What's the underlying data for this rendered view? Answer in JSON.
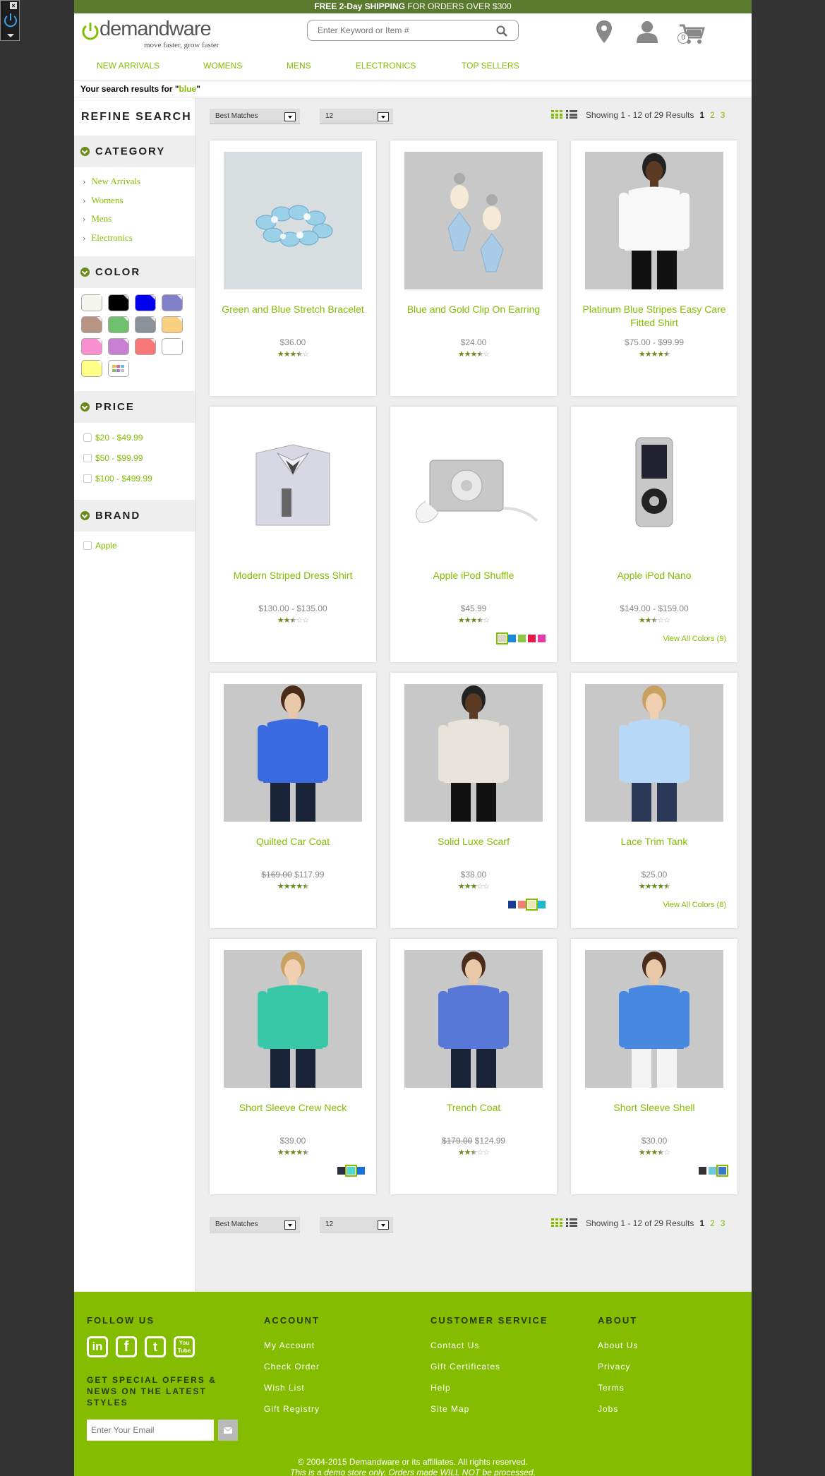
{
  "promo": {
    "bold": "FREE 2-Day SHIPPING",
    "rest": " FOR ORDERS OVER $300"
  },
  "logo": {
    "name": "demandware",
    "tagline": "move faster, grow faster"
  },
  "search": {
    "placeholder": "Enter Keyword or Item #"
  },
  "cart": {
    "count": "0"
  },
  "nav": [
    "NEW ARRIVALS",
    "WOMENS",
    "MENS",
    "ELECTRONICS",
    "TOP SELLERS"
  ],
  "results": {
    "prefix": "Your search results for \"",
    "query": "blue",
    "suffix": "\""
  },
  "sidebar": {
    "refine_title": "REFINE SEARCH",
    "category_title": "CATEGORY",
    "categories": [
      "New Arrivals",
      "Womens",
      "Mens",
      "Electronics"
    ],
    "color_title": "COLOR",
    "colors": [
      "#f5f5ef",
      "#000000",
      "#0000ee",
      "#8080c8",
      "#b89484",
      "#70c070",
      "#8c9098",
      "#f8d080",
      "#f890d0",
      "#c880d0",
      "#f87878",
      "#ffffff",
      "#ffff88",
      "multicolor"
    ],
    "price_title": "PRICE",
    "prices": [
      "$20 - $49.99",
      "$50 - $99.99",
      "$100 - $499.99"
    ],
    "brand_title": "BRAND",
    "brands": [
      "Apple"
    ]
  },
  "toolbar": {
    "sort_value": "Best Matches",
    "per_page_value": "12",
    "showing": "Showing 1 - 12 of 29 Results",
    "pages": [
      "1",
      "2",
      "3"
    ]
  },
  "products": [
    {
      "title": "Green and Blue Stretch Bracelet",
      "price": "$36.00",
      "old_price": "",
      "rating": 3.5,
      "swatches": [],
      "view_all": ""
    },
    {
      "title": "Blue and Gold Clip On Earring",
      "price": "$24.00",
      "old_price": "",
      "rating": 3.5,
      "swatches": [],
      "view_all": ""
    },
    {
      "title": "Platinum Blue Stripes Easy Care Fitted Shirt",
      "price": "$75.00 - $99.99",
      "old_price": "",
      "rating": 4.5,
      "swatches": [],
      "view_all": ""
    },
    {
      "title": "Modern Striped Dress Shirt",
      "price": "$130.00 - $135.00",
      "old_price": "",
      "rating": 2.5,
      "swatches": [],
      "view_all": ""
    },
    {
      "title": "Apple iPod Shuffle",
      "price": "$45.99",
      "old_price": "",
      "rating": 3.5,
      "swatches": [
        "#d8d8c0",
        "#1a8ad8",
        "#8cc840",
        "#e81848",
        "#e838a8"
      ],
      "view_all": ""
    },
    {
      "title": "Apple iPod Nano",
      "price": "$149.00 - $159.00",
      "old_price": "",
      "rating": 2.5,
      "swatches": [],
      "view_all": "View All Colors (9)"
    },
    {
      "title": "Quilted Car Coat",
      "price": "$117.99",
      "old_price": "$169.00",
      "rating": 4.5,
      "swatches": [],
      "view_all": ""
    },
    {
      "title": "Solid Luxe Scarf",
      "price": "$38.00",
      "old_price": "",
      "rating": 3,
      "swatches": [
        "#1a3a98",
        "#f08070",
        "#e8e8b8",
        "#20b8d0"
      ],
      "view_all": ""
    },
    {
      "title": "Lace Trim Tank",
      "price": "$25.00",
      "old_price": "",
      "rating": 4.5,
      "swatches": [],
      "view_all": "View All Colors (8)"
    },
    {
      "title": "Short Sleeve Crew Neck",
      "price": "$39.00",
      "old_price": "",
      "rating": 4.5,
      "swatches": [
        "#283040",
        "#50d8c8",
        "#1870d8"
      ],
      "view_all": ""
    },
    {
      "title": "Trench Coat",
      "price": "$124.99",
      "old_price": "$179.00",
      "rating": 2.5,
      "swatches": [],
      "view_all": ""
    },
    {
      "title": "Short Sleeve Shell",
      "price": "$30.00",
      "old_price": "",
      "rating": 3.5,
      "swatches": [
        "#333333",
        "#70c8d8",
        "#3878c8"
      ],
      "view_all": ""
    }
  ],
  "footer": {
    "follow_title": "FOLLOW US",
    "social": [
      "in",
      "f",
      "t",
      "You Tube"
    ],
    "offers": "GET SPECIAL OFFERS & NEWS ON THE LATEST STYLES",
    "email_placeholder": "Enter Your Email",
    "account_title": "ACCOUNT",
    "account_links": [
      "My Account",
      "Check Order",
      "Wish List",
      "Gift Registry"
    ],
    "service_title": "CUSTOMER SERVICE",
    "service_links": [
      "Contact Us",
      "Gift Certificates",
      "Help",
      "Site Map"
    ],
    "about_title": "ABOUT",
    "about_links": [
      "About Us",
      "Privacy",
      "Terms",
      "Jobs"
    ],
    "copyright": "© 2004-2015 Demandware or its affiliates. All rights reserved.",
    "demo_note": "This is a demo store only. Orders made WILL NOT be processed."
  },
  "colors": {
    "brand_green": "#84bd00",
    "dark_green": "#6b8a1a",
    "promo_bar": "#5a7a2e"
  }
}
